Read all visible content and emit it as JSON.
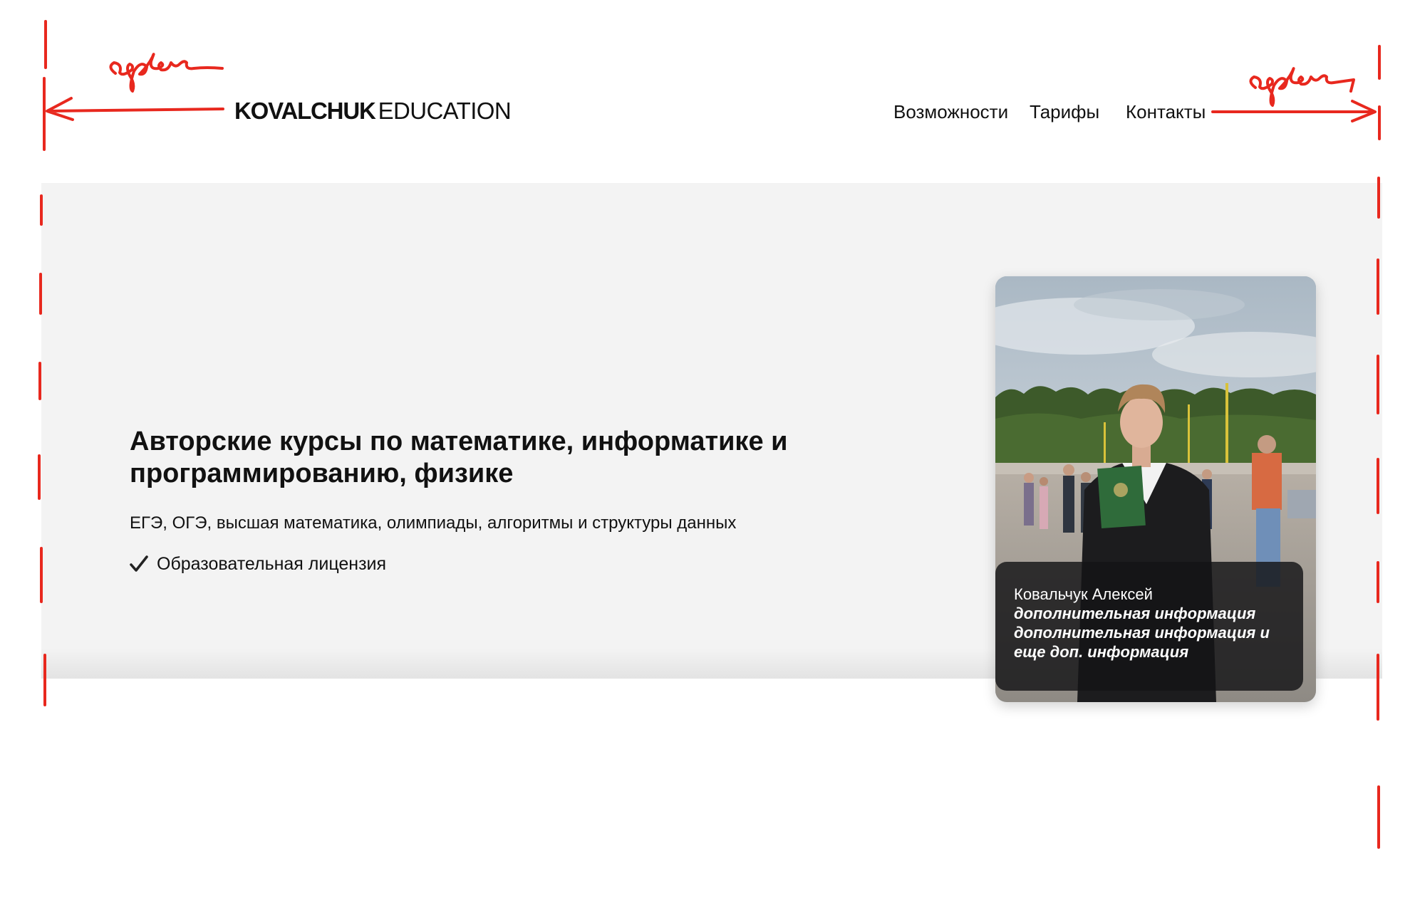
{
  "header": {
    "logo_bold": "KOVALCHUK",
    "logo_light": "EDUCATION",
    "nav": [
      {
        "label": "Возможности"
      },
      {
        "label": "Тарифы"
      },
      {
        "label": "Контакты"
      }
    ]
  },
  "hero": {
    "title": "Авторские курсы по математике, информатике и программированию, физике",
    "subtitle": "ЕГЭ, ОГЭ, высшая математика, олимпиады, алгоритмы и структуры данных",
    "license": "Образовательная лицензия",
    "license_icon": "check-icon"
  },
  "card": {
    "photo": "teacher-photo",
    "name": "Ковальчук Алексей",
    "info_lines": [
      "дополнительная информация",
      "дополнительная информация и",
      "еще доп. информация"
    ]
  },
  "annotations": {
    "left_note": "отступ",
    "right_note": "отступ"
  },
  "colors": {
    "hero_bg": "#f3f3f3",
    "annotation_red": "#e8281e",
    "text": "#111111"
  }
}
